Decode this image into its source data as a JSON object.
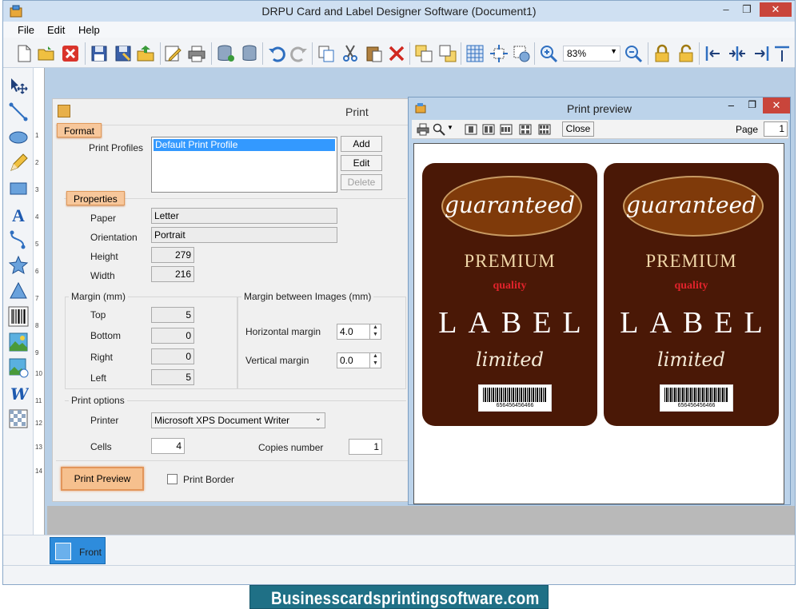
{
  "window": {
    "title": "DRPU Card and Label Designer Software  (Document1)",
    "controls": [
      "–",
      "❐",
      "✕"
    ]
  },
  "menu": [
    "File",
    "Edit",
    "Help"
  ],
  "toolbar": {
    "zoom": "83%",
    "icons": [
      "new-icon",
      "open-icon",
      "close-doc-icon",
      "save-icon",
      "save-as-icon",
      "export-icon",
      "edit-icon",
      "print-icon",
      "database-icon",
      "database2-icon",
      "undo-icon",
      "redo-icon",
      "copy-icon",
      "cut-icon",
      "paste-icon",
      "delete-icon",
      "layer-icon",
      "layer2-icon",
      "grid-icon",
      "center-icon",
      "settings-icon",
      "zoom-in-icon",
      "zoom-out-icon",
      "lock-icon",
      "unlock-icon",
      "align-left-icon",
      "align-center-icon",
      "align-right-icon",
      "align-top-icon"
    ]
  },
  "tools": [
    "select-icon",
    "line-icon",
    "ellipse-icon",
    "pencil-icon",
    "rectangle-icon",
    "text-icon",
    "curve-icon",
    "star-icon",
    "triangle-icon",
    "barcode-icon",
    "image-icon",
    "library-icon",
    "wordart-icon",
    "pattern-icon"
  ],
  "ruler": [
    "1",
    "2",
    "3",
    "4",
    "5",
    "6",
    "7",
    "8",
    "9",
    "10",
    "11",
    "12",
    "13",
    "14"
  ],
  "tab": {
    "label": "Front"
  },
  "print_panel": {
    "title": "Print",
    "format_label": "Format",
    "print_profiles_label": "Print Profiles",
    "profile_selected": "Default Print Profile",
    "add_button": "Add",
    "edit_button": "Edit",
    "delete_button": "Delete",
    "properties_label": "Properties",
    "paper_label": "Paper",
    "paper_value": "Letter",
    "orientation_label": "Orientation",
    "orientation_value": "Portrait",
    "height_label": "Height",
    "height_value": "279",
    "width_label": "Width",
    "width_value": "216",
    "margin_title": "Margin (mm)",
    "top_label": "Top",
    "top_value": "5",
    "bottom_label": "Bottom",
    "bottom_value": "0",
    "right_label": "Right",
    "right_value": "0",
    "left_label": "Left",
    "left_value": "5",
    "between_title": "Margin between Images (mm)",
    "hmargin_label": "Horizontal margin",
    "hmargin_value": "4.0",
    "vmargin_label": "Vertical margin",
    "vmargin_value": "0.0",
    "print_options_title": "Print options",
    "printer_label": "Printer",
    "printer_value": "Microsoft XPS Document Writer",
    "cells_label": "Cells",
    "cells_value": "4",
    "copies_label": "Copies number",
    "copies_value": "1",
    "print_preview_button": "Print Preview",
    "print_border_label": "Print Border"
  },
  "preview": {
    "title": "Print preview",
    "close_button": "Close",
    "page_label": "Page",
    "page_value": "1",
    "card": {
      "top_text": "guaranteed",
      "premium": "PREMIUM",
      "quality": "quality",
      "label": "LABEL",
      "limited": "limited",
      "barcode_number": "656456456466"
    },
    "card_colors": {
      "background": "#4a1806",
      "oval": "#7f3a0a",
      "accent_red": "#e0232b",
      "premium": "#efd6a8"
    }
  },
  "banner": {
    "text": "Businesscardsprintingsoftware.com"
  }
}
